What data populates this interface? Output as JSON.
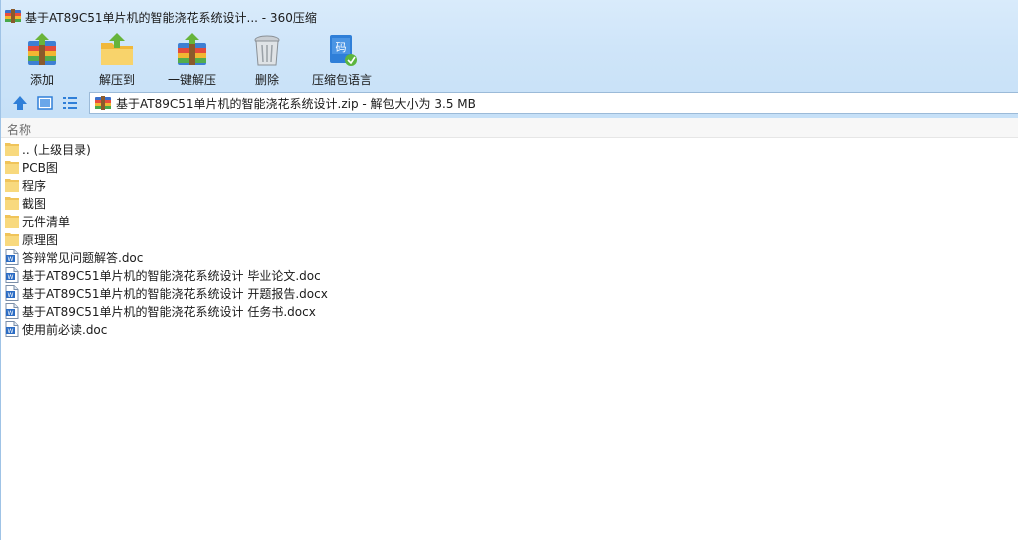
{
  "window": {
    "title": "基于AT89C51单片机的智能浇花系统设计... - 360压缩"
  },
  "toolbar": {
    "add_label": "添加",
    "extract_to_label": "解压到",
    "one_click_extract_label": "一键解压",
    "delete_label": "删除",
    "archive_language_label": "压缩包语言"
  },
  "navbar": {
    "path": "基于AT89C51单片机的智能浇花系统设计.zip - 解包大小为 3.5 MB"
  },
  "list": {
    "column_name": "名称",
    "items": [
      {
        "name": ".. (上级目录)",
        "type": "folder"
      },
      {
        "name": "PCB图",
        "type": "folder"
      },
      {
        "name": "程序",
        "type": "folder"
      },
      {
        "name": "截图",
        "type": "folder"
      },
      {
        "name": "元件清单",
        "type": "folder"
      },
      {
        "name": "原理图",
        "type": "folder"
      },
      {
        "name": "答辩常见问题解答.doc",
        "type": "doc"
      },
      {
        "name": "基于AT89C51单片机的智能浇花系统设计 毕业论文.doc",
        "type": "doc"
      },
      {
        "name": "基于AT89C51单片机的智能浇花系统设计 开题报告.docx",
        "type": "docx"
      },
      {
        "name": "基于AT89C51单片机的智能浇花系统设计 任务书.docx",
        "type": "docx"
      },
      {
        "name": "使用前必读.doc",
        "type": "doc"
      }
    ]
  },
  "colors": {
    "accent": "#2f7fd8",
    "folder": "#f6d36e",
    "toolbar_bg": "#cfe5f9"
  }
}
